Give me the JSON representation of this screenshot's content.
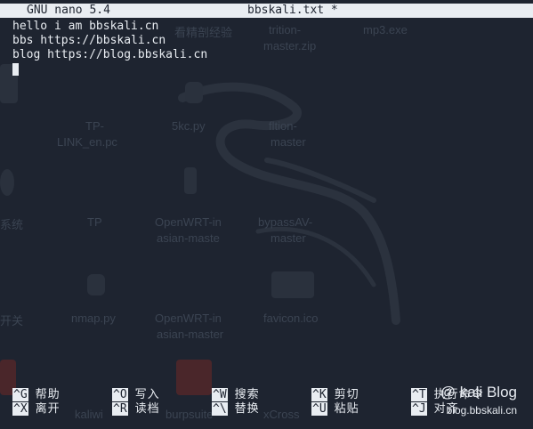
{
  "titlebar": {
    "app": "GNU nano 5.4",
    "filename": "bbskali.txt *"
  },
  "buffer": {
    "lines": [
      "hello i am bbskali.cn",
      "bbs https://bbskali.cn",
      "blog https://blog.bbskali.cn"
    ]
  },
  "shortcuts": [
    [
      {
        "key": "^G",
        "label": "帮助"
      },
      {
        "key": "^X",
        "label": "离开"
      }
    ],
    [
      {
        "key": "^O",
        "label": "写入"
      },
      {
        "key": "^R",
        "label": "读档"
      }
    ],
    [
      {
        "key": "^W",
        "label": "搜索"
      },
      {
        "key": "^\\",
        "label": "替换"
      }
    ],
    [
      {
        "key": "^K",
        "label": "剪切"
      },
      {
        "key": "^U",
        "label": "粘贴"
      }
    ],
    [
      {
        "key": "^T",
        "label": "执行命令"
      },
      {
        "key": "^J",
        "label": "对齐"
      }
    ]
  ],
  "desktop_labels": [
    "看精剖经验",
    "trition-",
    "master.zip",
    "mp3.exe",
    "TP-",
    "LINK_en.pc",
    "5kc.py",
    "fltion-",
    "master",
    "系统",
    "TP",
    "OpenWRT-in",
    "asian-maste",
    "bypassAV-",
    "master",
    "开关",
    "nmap.py",
    "OpenWRT-in",
    "asian-master",
    "favicon.ico",
    "kaliwi",
    "burpsuite",
    "xCross"
  ],
  "watermark": {
    "title": "@ kali Blog",
    "url": "blog.bbskali.cn"
  },
  "colors": {
    "background": "#1e2430",
    "foreground": "#e9edf2"
  }
}
